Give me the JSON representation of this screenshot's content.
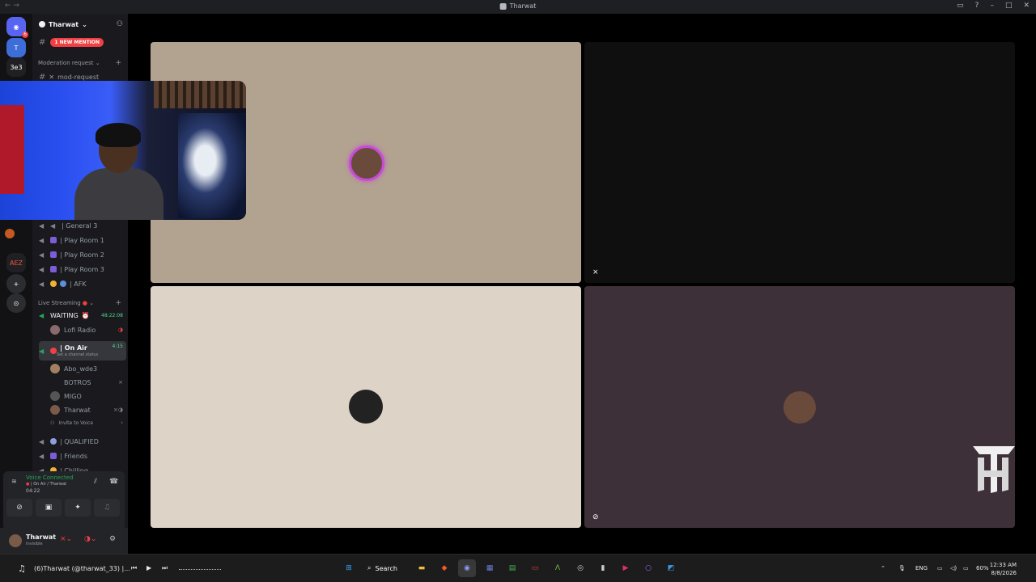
{
  "window": {
    "title": "Tharwat"
  },
  "guild": {
    "name": "Tharwat"
  },
  "servers": [
    {
      "label": "3e3"
    },
    {
      "label": "AEZ"
    }
  ],
  "mention_pill": "1 NEW MENTION",
  "categories": {
    "moderation": "Moderation request",
    "live": "Live Streaming"
  },
  "channels": {
    "mod_request": "mod-request",
    "general3": "| General 3",
    "play1": "| Play Room 1",
    "play2": "| Play Room 2",
    "play3": "| Play Room 3",
    "afk": "| AFK",
    "waiting": "WAITING",
    "waiting_timer": "48:22:08",
    "lofi": "Lofi Radio",
    "on_air": "| On Air",
    "on_air_timer": "4:15",
    "on_air_status": "Set a channel status",
    "qualified": "| QUALIFIED",
    "friends": "| Friends",
    "chilling": "| Chilling"
  },
  "voice_users": [
    "Abo_wde3",
    "BOTROS",
    "MIGO",
    "Tharwat"
  ],
  "invite_label": "Invite to Voice",
  "voice_panel": {
    "status": "Voice Connected",
    "channel": "| On Air / Tharwat",
    "time": "04:22"
  },
  "user": {
    "name": "Tharwat",
    "status": "Invisible"
  },
  "stage_colors": {
    "tile1": "#b2a290",
    "tile2": "#0f0f0f",
    "tile3": "#ddd3c7",
    "tile4": "#3e3038"
  },
  "taskbar": {
    "now_playing": "(6)Tharwat (@tharwat_33) |...",
    "search": "Search",
    "lang": "ENG",
    "battery": "60%",
    "time": "12:33 AM",
    "date": "8/8/2026"
  }
}
